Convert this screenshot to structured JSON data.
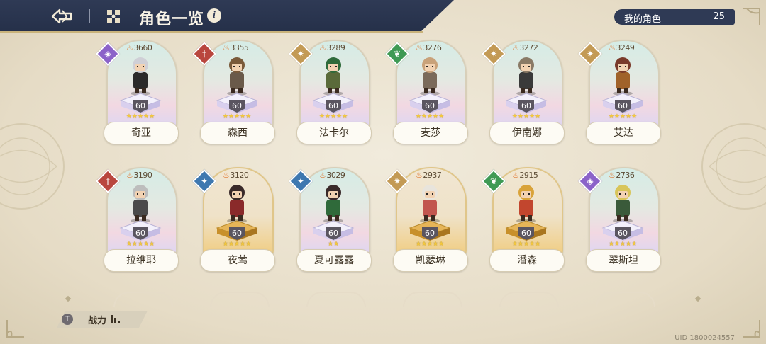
{
  "header": {
    "title": "角色一览",
    "info_icon": "i",
    "my_characters_label": "我的角色",
    "my_characters_count": "25"
  },
  "characters": [
    {
      "name": "奇亚",
      "power": "3660",
      "level": "60",
      "stars": 5,
      "element": "arcane",
      "elem_color": "#8b63c9",
      "frame": "pastel"
    },
    {
      "name": "森西",
      "power": "3355",
      "level": "60",
      "stars": 5,
      "element": "sword",
      "elem_color": "#b9463e",
      "frame": "pastel"
    },
    {
      "name": "法卡尔",
      "power": "3289",
      "level": "60",
      "stars": 5,
      "element": "light",
      "elem_color": "#c39a55",
      "frame": "pastel"
    },
    {
      "name": "麦莎",
      "power": "3276",
      "level": "60",
      "stars": 5,
      "element": "nature",
      "elem_color": "#3f9a55",
      "frame": "pastel"
    },
    {
      "name": "伊南娜",
      "power": "3272",
      "level": "60",
      "stars": 5,
      "element": "light",
      "elem_color": "#c39a55",
      "frame": "pastel"
    },
    {
      "name": "艾达",
      "power": "3249",
      "level": "60",
      "stars": 5,
      "element": "light",
      "elem_color": "#c39a55",
      "frame": "pastel"
    },
    {
      "name": "拉维耶",
      "power": "3190",
      "level": "60",
      "stars": 5,
      "element": "sword",
      "elem_color": "#b9463e",
      "frame": "pastel"
    },
    {
      "name": "夜莺",
      "power": "3120",
      "level": "60",
      "stars": 5,
      "element": "water",
      "elem_color": "#3e78b0",
      "frame": "gold"
    },
    {
      "name": "夏可露露",
      "power": "3029",
      "level": "60",
      "stars": 2,
      "element": "water",
      "elem_color": "#3e78b0",
      "frame": "pastel"
    },
    {
      "name": "凯瑟琳",
      "power": "2937",
      "level": "60",
      "stars": 5,
      "element": "light",
      "elem_color": "#c39a55",
      "frame": "gold"
    },
    {
      "name": "潘森",
      "power": "2915",
      "level": "60",
      "stars": 5,
      "element": "nature",
      "elem_color": "#3f9a55",
      "frame": "gold"
    },
    {
      "name": "翠斯坦",
      "power": "2736",
      "level": "60",
      "stars": 5,
      "element": "arcane",
      "elem_color": "#8b63c9",
      "frame": "pastel"
    }
  ],
  "footer": {
    "sort_badge": "T",
    "sort_label": "战力",
    "uid": "UID 1800024557"
  }
}
